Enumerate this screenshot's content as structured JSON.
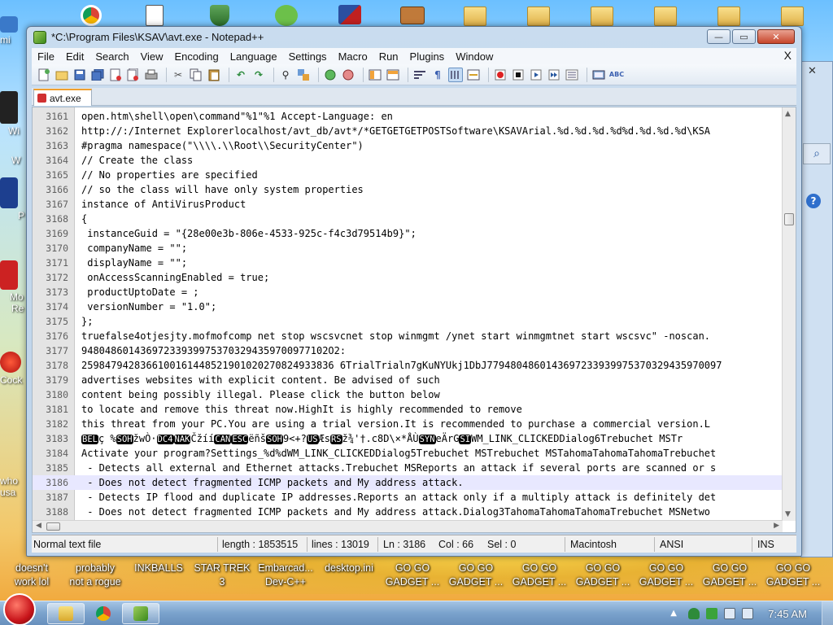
{
  "window": {
    "title": "*C:\\Program Files\\KSAV\\avt.exe - Notepad++",
    "btn_min": "—",
    "btn_max": "▭",
    "btn_close": "✕"
  },
  "menu": {
    "items": [
      "File",
      "Edit",
      "Search",
      "View",
      "Encoding",
      "Language",
      "Settings",
      "Macro",
      "Run",
      "Plugins",
      "Window"
    ],
    "doc_close": "X"
  },
  "toolbar": {
    "icons": [
      "new-icon",
      "open-icon",
      "save-icon",
      "save-all-icon",
      "close-icon",
      "close-all-icon",
      "print-icon",
      "cut-icon",
      "copy-icon",
      "paste-icon",
      "undo-icon",
      "redo-icon",
      "find-icon",
      "replace-icon",
      "zoom-in-icon",
      "zoom-out-icon",
      "sync-v-icon",
      "sync-h-icon",
      "word-wrap-icon",
      "all-chars-icon",
      "indent-guide-icon",
      "fold-icon",
      "record-icon",
      "stop-icon",
      "play-icon",
      "run-multi-icon",
      "save-macro-icon",
      "launch-icon",
      "spellcheck-icon"
    ]
  },
  "tab": {
    "label": "avt.exe"
  },
  "editor": {
    "current_line": "3186",
    "lines": [
      {
        "n": "3161",
        "t": "open.htm\\shell\\open\\command\"%1\"%1 Accept-Language: en"
      },
      {
        "n": "3162",
        "t": "http://:/Internet Explorerlocalhost/avt_db/avt*/*GETGETGETPOSTSoftware\\KSAVArial.%d.%d.%d.%d%d.%d.%d.%d\\KSA"
      },
      {
        "n": "3163",
        "t": "#pragma namespace(\"\\\\\\\\.\\\\Root\\\\SecurityCenter\")"
      },
      {
        "n": "3164",
        "t": "// Create the class"
      },
      {
        "n": "3165",
        "t": "// No properties are specified"
      },
      {
        "n": "3166",
        "t": "// so the class will have only system properties"
      },
      {
        "n": "3167",
        "t": "instance of AntiVirusProduct"
      },
      {
        "n": "3168",
        "t": "{"
      },
      {
        "n": "3169",
        "t": " instanceGuid = \"{28e00e3b-806e-4533-925c-f4c3d79514b9}\";"
      },
      {
        "n": "3170",
        "t": " companyName = \"\";"
      },
      {
        "n": "3171",
        "t": " displayName = \"\";"
      },
      {
        "n": "3172",
        "t": " onAccessScanningEnabled = true;"
      },
      {
        "n": "3173",
        "t": " productUptoDate = ;"
      },
      {
        "n": "3174",
        "t": " versionNumber = \"1.0\";"
      },
      {
        "n": "3175",
        "t": "};"
      },
      {
        "n": "3176",
        "t": "truefalse4otjesjty.mofmofcomp net stop wscsvcnet stop winmgmt /ynet start winmgmtnet start wscsvc\" -noscan."
      },
      {
        "n": "3177",
        "t": "948048601436972339399753703294359700977102O2:"
      },
      {
        "n": "3178",
        "t": "2598479428366100161448521901020270824933836 6TrialTrialn7gKuNYUkj1DbJ7794804860143697233939975370329435970097"
      },
      {
        "n": "3179",
        "t": "advertises websites with explicit content. Be advised of such"
      },
      {
        "n": "3180",
        "t": "content being possibly illegal. Please click the button below"
      },
      {
        "n": "3181",
        "t": "to locate and remove this threat now.HighIt is highly recommended to remove"
      },
      {
        "n": "3182",
        "t": "this threat from your PC.You are using a trial version.It is recommended to purchase a commercial version.L"
      },
      {
        "n": "3183",
        "t": "",
        "segments": [
          {
            "ctl": "BEL"
          },
          {
            "t": "ç %"
          },
          {
            "ctl": "SOH"
          },
          {
            "t": "žwÒ·"
          },
          {
            "ctl": "DC4"
          },
          {
            "ctl": "NAK"
          },
          {
            "t": "Čžíí"
          },
          {
            "ctl": "CAN"
          },
          {
            "ctl": "ESC"
          },
          {
            "t": "ëñš"
          },
          {
            "ctl": "SOH"
          },
          {
            "t": "9<+?"
          },
          {
            "ctl": "US"
          },
          {
            "t": "Æs"
          },
          {
            "ctl": "RS"
          },
          {
            "t": "ž¾'†.c8D\\×*ÅÙ"
          },
          {
            "ctl": "SYN"
          },
          {
            "t": "eÄrG"
          },
          {
            "ctl": "SI"
          },
          {
            "t": "WM_LINK_CLICKEDDialog6Trebuchet MSTr"
          }
        ]
      },
      {
        "n": "3184",
        "t": "Activate your program?Settings_%d%dWM_LINK_CLICKEDDialog5Trebuchet MSTrebuchet MSTahomaTahomaTahomaTrebuchet"
      },
      {
        "n": "3185",
        "t": " - Detects all external and Ethernet attacks.Trebuchet MSReports an attack if several ports are scanned or s"
      },
      {
        "n": "3186",
        "t": " - Does not detect fragmented ICMP packets and My address attack."
      },
      {
        "n": "3187",
        "t": " - Detects IP flood and duplicate IP addresses.Reports an attack only if a multiply attack is definitely det"
      },
      {
        "n": "3188",
        "t": " - Does not detect fragmented ICMP packets and My address attack.Dialog3TahomaTahomaTahomaTrebuchet MSNetwo"
      }
    ]
  },
  "status": {
    "file_type": "Normal text file",
    "length": "length : 1853515",
    "lines": "lines : 13019",
    "ln": "Ln : 3186",
    "col": "Col : 66",
    "sel": "Sel : 0",
    "eol": "Macintosh",
    "encoding": "ANSI",
    "ins": "INS"
  },
  "desktop": {
    "bottom_labels": [
      [
        "doesn't",
        "work lol"
      ],
      [
        "probably",
        "not a rogue"
      ],
      [
        "INKBALLS",
        ""
      ],
      [
        "STAR TREK",
        "3"
      ],
      [
        "Embarcad...",
        "Dev-C++"
      ],
      [
        "desktop.ini",
        ""
      ],
      [
        "GO GO",
        "GADGET ..."
      ],
      [
        "GO GO",
        "GADGET ..."
      ],
      [
        "GO GO",
        "GADGET ..."
      ],
      [
        "GO GO",
        "GADGET ..."
      ],
      [
        "GO GO",
        "GADGET ..."
      ],
      [
        "GO GO",
        "GADGET ..."
      ],
      [
        "GO GO",
        "GADGET ..."
      ]
    ],
    "left_labels": [
      "mi",
      "Wi",
      "W",
      "P",
      "Mo",
      "Re",
      "Cock",
      "who",
      "usa"
    ]
  },
  "taskbar": {
    "clock": "7:45 AM"
  },
  "colors": {
    "accent": "#f0a030",
    "selection_line": "#e8e8ff"
  }
}
